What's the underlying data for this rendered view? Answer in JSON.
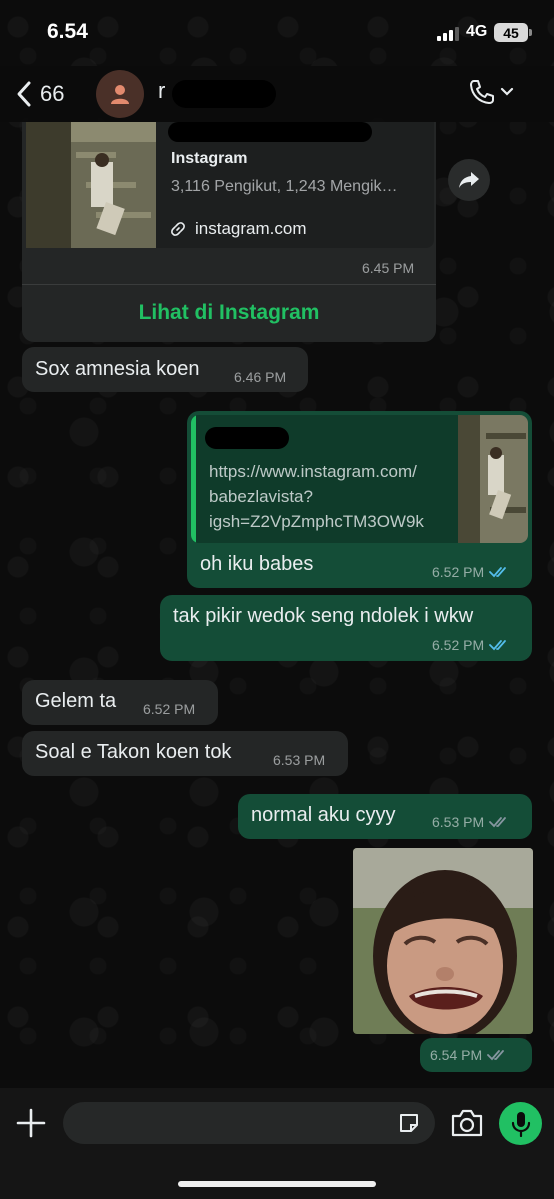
{
  "status_bar": {
    "time": "6.54",
    "network": "4G",
    "battery": "45"
  },
  "header": {
    "back_count": "66",
    "contact_name": "r"
  },
  "messages": {
    "ig_card": {
      "title": "Instagram",
      "description": "3,116 Pengikut, 1,243 Mengik…",
      "domain": "instagram.com",
      "time": "6.45 PM",
      "action": "Lihat di Instagram"
    },
    "m1": {
      "text": "Sox amnesia koen",
      "time": "6.46 PM"
    },
    "m2": {
      "quoted_link": "https://www.instagram.com/\nbabezlavista?\nigsh=Z2VpZmphcTM3OW9k",
      "text": "oh iku babes",
      "time": "6.52 PM"
    },
    "m3": {
      "text": "tak pikir wedok seng ndolek i wkw",
      "time": "6.52 PM"
    },
    "m4": {
      "text": "Gelem ta",
      "time": "6.52 PM"
    },
    "m5": {
      "text": "Soal e Takon koen tok",
      "time": "6.53 PM"
    },
    "m6": {
      "text": "normal aku cyyy",
      "time": "6.53 PM"
    },
    "m7": {
      "time": "6.54 PM"
    }
  },
  "colors": {
    "incoming_bubble": "#242626",
    "outgoing_bubble": "#144d37",
    "accent_green": "#21c063",
    "read_ticks": "#53bdeb",
    "delivered_ticks": "#8696a0"
  },
  "icons": {
    "back": "chevron-left-icon",
    "avatar": "person-icon",
    "call": "phone-icon",
    "forward": "forward-icon",
    "link": "link-icon",
    "plus": "plus-icon",
    "sticker": "sticker-icon",
    "camera": "camera-icon",
    "mic": "microphone-icon"
  }
}
